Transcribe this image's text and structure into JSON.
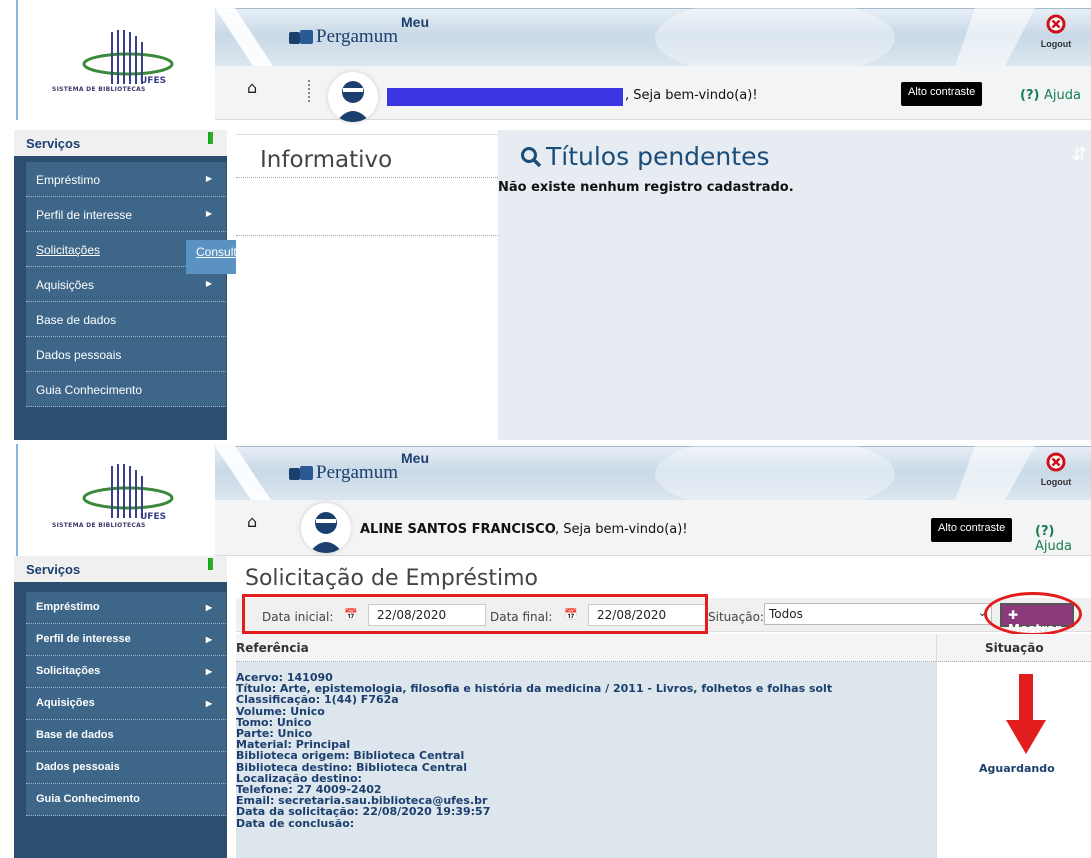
{
  "brand": {
    "meu": "Meu",
    "name": "Pergamum",
    "logo_text": "SISTEMA DE BIBLIOTECAS",
    "logo_abbr": "UFES",
    "logout": "Logout"
  },
  "user_bar": {
    "welcome": ", Seja bem-vindo(a)!",
    "contrast": "Alto contraste",
    "help_prefix": "(?)",
    "help_label": "Ajuda"
  },
  "sidebar": {
    "title": "Serviços",
    "items": [
      {
        "label": "Empréstimo",
        "arrow": true
      },
      {
        "label": "Perfil de interesse",
        "arrow": true
      },
      {
        "label": "Solicitações",
        "arrow": false
      },
      {
        "label": "Aquisições",
        "arrow": true
      },
      {
        "label": "Base de dados",
        "arrow": false
      },
      {
        "label": "Dados pessoais",
        "arrow": false
      },
      {
        "label": "Guia Conhecimento",
        "arrow": false
      }
    ]
  },
  "screen1": {
    "submenu": "Consulta ao malote",
    "info_title": "Informativo",
    "pending_title": "Títulos pendentes",
    "pending_empty": "Não existe nenhum registro cadastrado."
  },
  "screen2": {
    "user_name": "ALINE SANTOS FRANCISCO",
    "sidebar_items": [
      {
        "label": "Empréstimo",
        "arrow": true
      },
      {
        "label": "Perfil de interesse",
        "arrow": true
      },
      {
        "label": "Solicitações",
        "arrow": true
      },
      {
        "label": "Aquisições",
        "arrow": true
      },
      {
        "label": "Base de dados",
        "arrow": false
      },
      {
        "label": "Dados pessoais",
        "arrow": false
      },
      {
        "label": "Guia Conhecimento",
        "arrow": false
      }
    ],
    "page_title": "Solicitação de Empréstimo",
    "filter": {
      "start_label": "Data inicial:",
      "start_value": "22/08/2020",
      "end_label": "Data final:",
      "end_value": "22/08/2020",
      "status_label": "Situação:",
      "status_value": "Todos",
      "show_button": "Mostrar"
    },
    "table": {
      "col_ref": "Referência",
      "col_status": "Situação",
      "record": [
        "Acervo: 141090",
        "Título: Arte, epistemologia, filosofia e história da medicina / 2011 - Livros, folhetos e folhas solt",
        "Classificação: 1(44)  F762a",
        "Volume: Unico",
        "Tomo: Unico",
        "Parte: Unico",
        "Material: Principal",
        "Biblioteca origem: Biblioteca Central",
        "Biblioteca destino: Biblioteca Central",
        "Localização destino:",
        "Telefone: 27 4009-2402",
        "Email: secretaria.sau.biblioteca@ufes.br",
        "Data da solicitação: 22/08/2020 19:39:57",
        "Data de conclusão:"
      ],
      "status": "Aguardando"
    }
  },
  "colors": {
    "sidebar": "#2c4f70",
    "sidebar_item": "#3d6689",
    "title_blue": "#1b4d7a",
    "help_green": "#1a7d4f",
    "annotation_red": "#e21d1d",
    "button": "#8a3a7a"
  }
}
